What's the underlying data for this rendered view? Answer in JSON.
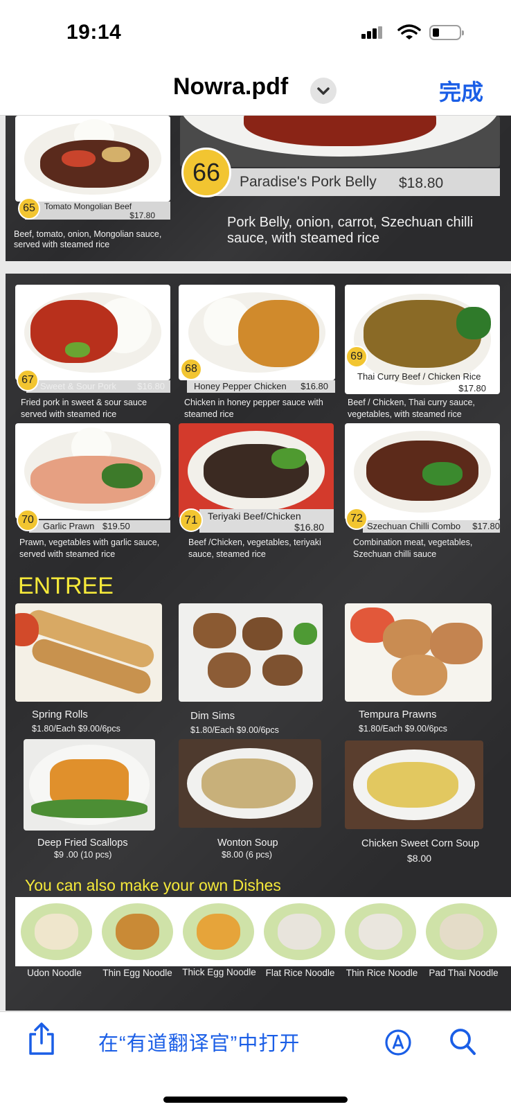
{
  "status_bar": {
    "time": "19:14"
  },
  "nav": {
    "title": "Nowra.pdf",
    "done": "完成"
  },
  "page1": {
    "item65": {
      "num": "65",
      "name": "Tomato Mongolian Beef",
      "price": "$17.80",
      "desc": "Beef, tomato, onion, Mongolian sauce, served with steamed rice"
    },
    "item66": {
      "num": "66",
      "name": "Paradise's Pork Belly",
      "price": "$18.80",
      "desc": "Pork Belly, onion, carrot, Szechuan chilli sauce, with steamed rice"
    }
  },
  "items": [
    {
      "num": "67",
      "name": "Sweet & Sour Pork",
      "price": "$16.80",
      "desc": "Fried pork in sweet & sour sauce served with steamed rice"
    },
    {
      "num": "68",
      "name": "Honey Pepper Chicken",
      "price": "$16.80",
      "desc": "Chicken in honey pepper sauce with steamed rice"
    },
    {
      "num": "69",
      "name": "Thai Curry Beef / Chicken Rice",
      "price": "$17.80",
      "desc": "Beef / Chicken, Thai curry sauce, vegetables, with steamed rice"
    },
    {
      "num": "70",
      "name": "Garlic Prawn",
      "price": "$19.50",
      "desc": "Prawn, vegetables with garlic sauce, served with steamed rice"
    },
    {
      "num": "71",
      "name": "Teriyaki  Beef/Chicken",
      "price": "$16.80",
      "desc": "Beef /Chicken, vegetables, teriyaki sauce, steamed rice"
    },
    {
      "num": "72",
      "name": "Szechuan Chilli Combo",
      "price": "$17.80",
      "desc": "Combination meat, vegetables, Szechuan chilli sauce"
    }
  ],
  "entree": {
    "heading": "ENTREE",
    "items": [
      {
        "name": "Spring Rolls",
        "price": "$1.80/Each $9.00/6pcs"
      },
      {
        "name": "Dim Sims",
        "price": "$1.80/Each $9.00/6pcs"
      },
      {
        "name": "Tempura Prawns",
        "price": "$1.80/Each  $9.00/6pcs"
      },
      {
        "name": "Deep Fried  Scallops",
        "price": "$9 .00 (10 pcs)"
      },
      {
        "name": "Wonton Soup",
        "price": "$8.00 (6 pcs)"
      },
      {
        "name": "Chicken Sweet Corn Soup",
        "price": "$8.00"
      }
    ]
  },
  "own_dishes": {
    "heading": "You can also make your own Dishes",
    "noodles": [
      "Udon Noodle",
      "Thin Egg Noodle",
      "Thick Egg Noodle",
      "Flat Rice Noodle",
      "Thin Rice Noodle",
      "Pad Thai Noodle"
    ]
  },
  "toolbar": {
    "open_in": "在“有道翻译官”中打开"
  },
  "colors": {
    "accent": "#1a5ee6",
    "badge": "#f2c531",
    "heading_yellow": "#f5e93a",
    "page_bg": "#2b2b2d"
  },
  "icons": [
    "signal-icon",
    "wifi-icon",
    "battery-icon",
    "chevron-down-icon",
    "share-icon",
    "markup-icon",
    "search-icon"
  ]
}
